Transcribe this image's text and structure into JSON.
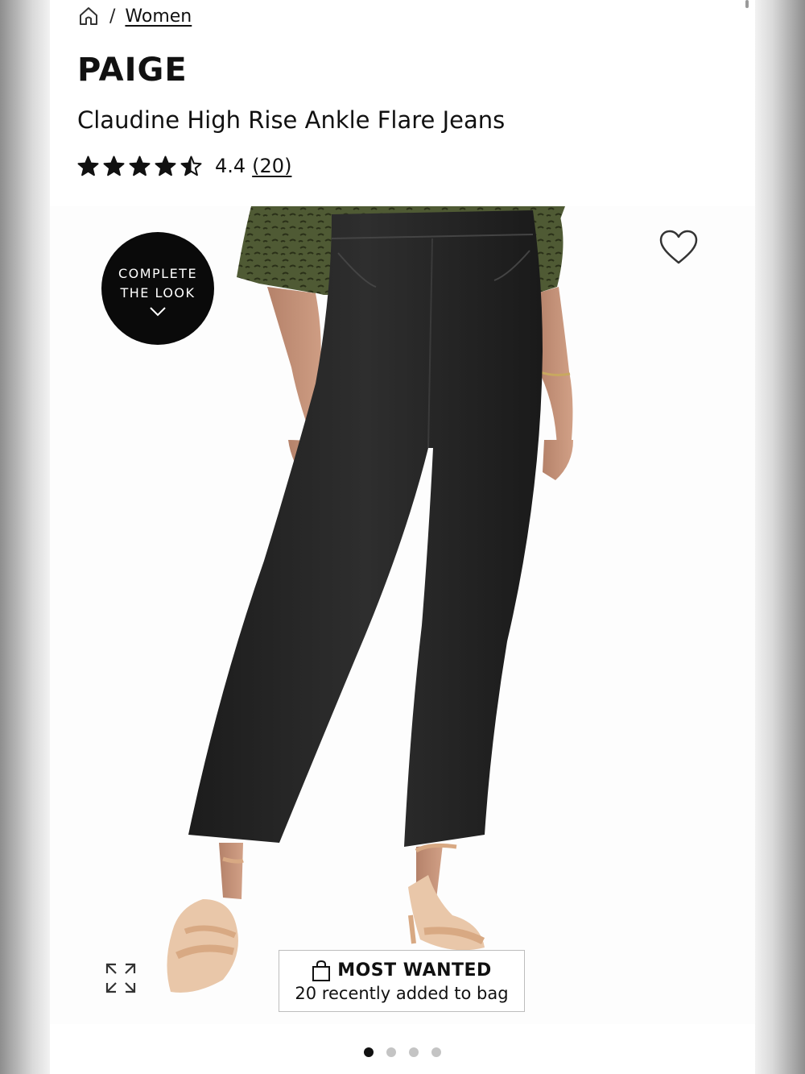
{
  "breadcrumb": {
    "home_icon": "home-icon",
    "separator": "/",
    "current": "Women"
  },
  "product": {
    "brand": "PAIGE",
    "name": "Claudine High Rise Ankle Flare Jeans"
  },
  "rating": {
    "stars_out_of_5": 4.4,
    "value": "4.4",
    "count": "(20)"
  },
  "hero": {
    "complete_look_label": "COMPLETE THE LOOK",
    "wishlist_icon": "heart-icon",
    "expand_icon": "expand-arrows-icon"
  },
  "badge": {
    "icon": "shopping-bag-icon",
    "title": "MOST WANTED",
    "subtitle": "20 recently added to bag"
  },
  "carousel": {
    "total_slides": 4,
    "active_slide": 1
  },
  "colors": {
    "text": "#111111",
    "badge_border": "#bdbdbd",
    "dot_active": "#111111",
    "dot_inactive": "#c4c4c4",
    "complete_look_bg": "#0a0a0a"
  }
}
